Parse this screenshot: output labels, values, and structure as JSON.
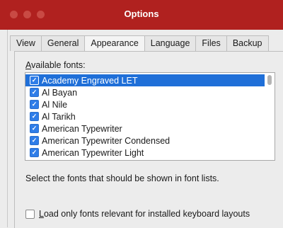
{
  "window": {
    "title": "Options"
  },
  "tabs": [
    {
      "label": "View"
    },
    {
      "label": "General"
    },
    {
      "label": "Appearance"
    },
    {
      "label": "Language"
    },
    {
      "label": "Files"
    },
    {
      "label": "Backup"
    }
  ],
  "active_tab": "Appearance",
  "fonts_section": {
    "label_mnemonic": "A",
    "label_rest": "vailable fonts:",
    "items": [
      {
        "name": "Academy Engraved LET",
        "checked": true,
        "selected": true
      },
      {
        "name": "Al Bayan",
        "checked": true
      },
      {
        "name": "Al Nile",
        "checked": true
      },
      {
        "name": "Al Tarikh",
        "checked": true
      },
      {
        "name": "American Typewriter",
        "checked": true
      },
      {
        "name": "American Typewriter Condensed",
        "checked": true
      },
      {
        "name": "American Typewriter Light",
        "checked": true
      }
    ],
    "hint": "Select the fonts that should be shown in font lists."
  },
  "keyboard_option": {
    "mnemonic": "L",
    "label_rest": "oad only fonts relevant for installed keyboard layouts",
    "checked": false
  },
  "icons": {
    "check": "checkmark-icon"
  },
  "colors": {
    "titlebar": "#b0211f",
    "selection": "#1f6fd8",
    "checkbox": "#2f7de8"
  }
}
